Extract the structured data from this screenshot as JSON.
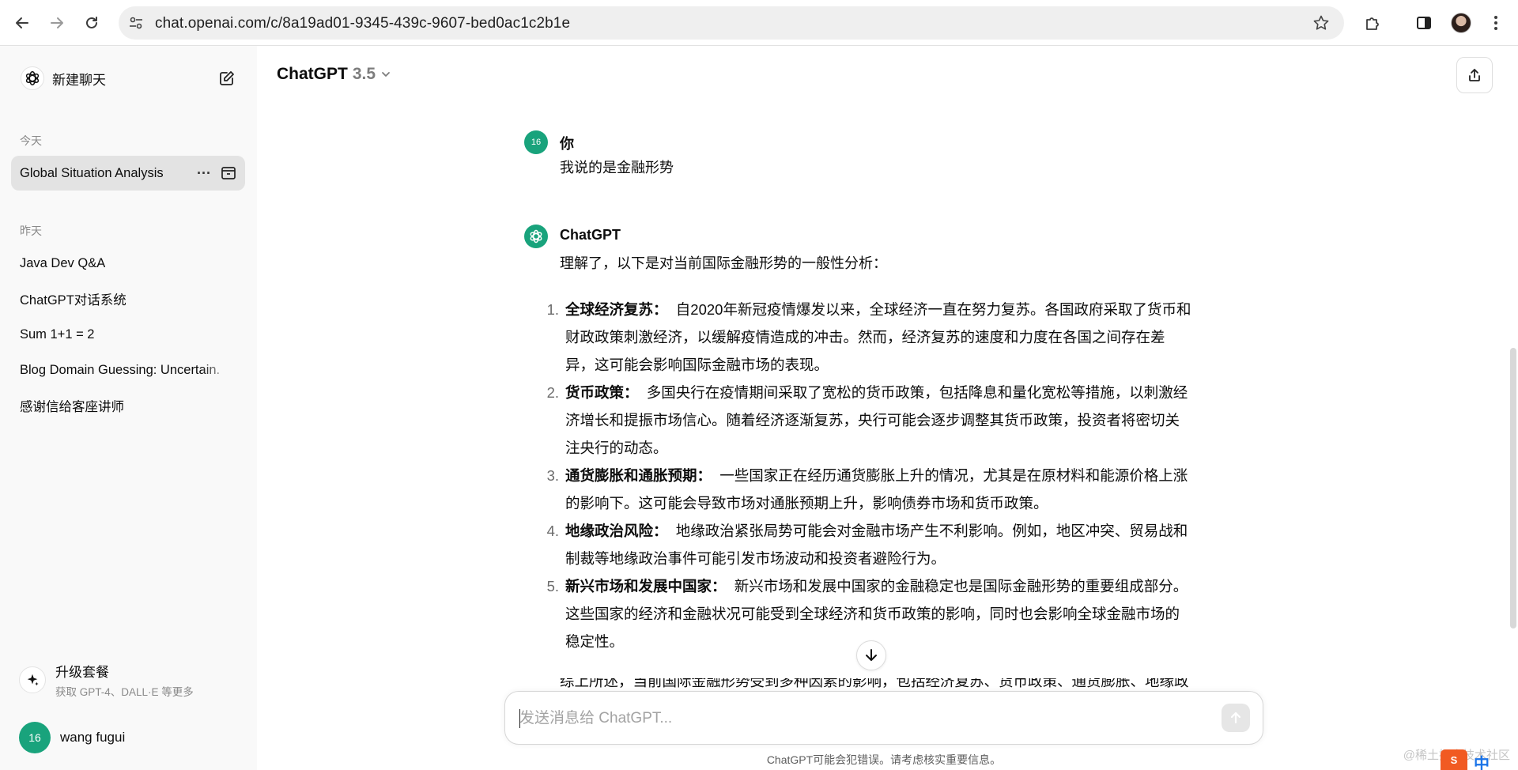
{
  "browser": {
    "url": "chat.openai.com/c/8a19ad01-9345-439c-9607-bed0ac1c2b1e"
  },
  "sidebar": {
    "new_chat_label": "新建聊天",
    "sections": [
      {
        "label": "今天",
        "items": [
          {
            "label": "Global Situation Analysis",
            "active": true
          }
        ]
      },
      {
        "label": "昨天",
        "items": [
          {
            "label": "Java Dev Q&A"
          },
          {
            "label": "ChatGPT对话系统"
          },
          {
            "label": "Sum 1+1 = 2"
          },
          {
            "label": "Blog Domain Guessing: Uncertain."
          },
          {
            "label": "感谢信给客座讲师"
          }
        ]
      }
    ],
    "more_glyph": "···",
    "upgrade": {
      "title": "升级套餐",
      "subtitle": "获取 GPT-4、DALL·E 等更多"
    },
    "user": {
      "avatar_text": "16",
      "name": "wang fugui"
    }
  },
  "header": {
    "model_name": "ChatGPT",
    "model_version": "3.5"
  },
  "conversation": {
    "user_message": {
      "avatar_text": "16",
      "author": "你",
      "text": "我说的是金融形势"
    },
    "assistant_message": {
      "author": "ChatGPT",
      "intro": "理解了，以下是对当前国际金融形势的一般性分析：",
      "points": [
        {
          "num": "1.",
          "head": "全球经济复苏：",
          "lines": [
            "自2020年新冠疫情爆发以来，全球经济一直在努力复苏。各国政府采取了货币和",
            "财政政策刺激经济，以缓解疫情造成的冲击。然而，经济复苏的速度和力度在各国之间存在差",
            "异，这可能会影响国际金融市场的表现。"
          ]
        },
        {
          "num": "2.",
          "head": "货币政策：",
          "lines": [
            "多国央行在疫情期间采取了宽松的货币政策，包括降息和量化宽松等措施，以刺激经",
            "济增长和提振市场信心。随着经济逐渐复苏，央行可能会逐步调整其货币政策，投资者将密切关",
            "注央行的动态。"
          ]
        },
        {
          "num": "3.",
          "head": "通货膨胀和通胀预期：",
          "lines": [
            "一些国家正在经历通货膨胀上升的情况，尤其是在原材料和能源价格上涨",
            "的影响下。这可能会导致市场对通胀预期上升，影响债券市场和货币政策。"
          ]
        },
        {
          "num": "4.",
          "head": "地缘政治风险：",
          "lines": [
            "地缘政治紧张局势可能会对金融市场产生不利影响。例如，地区冲突、贸易战和",
            "制裁等地缘政治事件可能引发市场波动和投资者避险行为。"
          ]
        },
        {
          "num": "5.",
          "head": "新兴市场和发展中国家：",
          "lines": [
            "新兴市场和发展中国家的金融稳定也是国际金融形势的重要组成部分。",
            "这些国家的经济和金融状况可能受到全球经济和货币政策的影响，同时也会影响全球金融市场的",
            "稳定性。"
          ]
        }
      ],
      "summary_partial": "综上所述，当前国际金融形势受到多种因素的影响，包括经济复苏、货币政策、通货膨胀、地缘政"
    }
  },
  "composer": {
    "placeholder": "发送消息给 ChatGPT..."
  },
  "footer_note": "ChatGPT可能会犯错误。请考虑核实重要信息。",
  "overlay": {
    "watermark": "@稀土掘金技术社区",
    "ime_badge": "S",
    "ime_lang": "中"
  },
  "colors": {
    "accent_green": "#19a37c",
    "sidebar_bg": "#f9f9f9",
    "active_item_bg": "#e3e3e3"
  }
}
